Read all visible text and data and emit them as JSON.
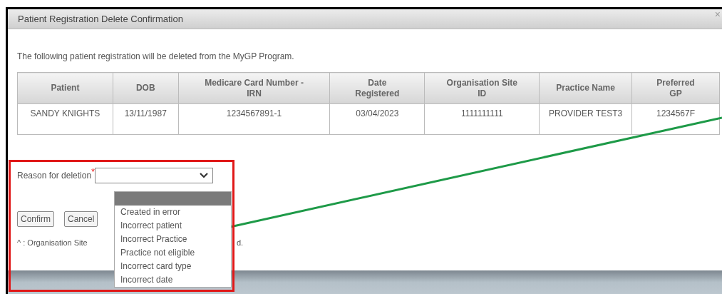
{
  "window": {
    "title": "Patient Registration Delete Confirmation",
    "close": "×"
  },
  "intro": "The following patient registration will be deleted from the MyGP Program.",
  "table": {
    "columns": [
      "Patient",
      "DOB",
      "Medicare Card Number - IRN",
      "Date Registered",
      "Organisation Site ID",
      "Practice Name",
      "Preferred GP"
    ],
    "rows": [
      [
        "SANDY KNIGHTS",
        "13/11/1987",
        "1234567891-1",
        "03/04/2023",
        "1111111111",
        "PROVIDER TEST3",
        "1234567F"
      ]
    ]
  },
  "reason": {
    "label": "Reason for deletion",
    "required_mark": "*"
  },
  "dropdown_options": [
    {
      "selected": true
    },
    {
      "label": "Created in error",
      "selected": false
    },
    {
      "label": "Incorrect patient",
      "selected": false
    },
    {
      "label": "Incorrect Practice",
      "selected": false
    },
    {
      "label": "Practice not eligible",
      "selected": false
    },
    {
      "label": "Incorrect card type",
      "selected": false
    },
    {
      "label": "Incorrect date",
      "selected": false
    }
  ],
  "buttons": [
    "Confirm",
    "Cancel"
  ],
  "footnote": [
    "^ : Organisation Site",
    "d."
  ]
}
